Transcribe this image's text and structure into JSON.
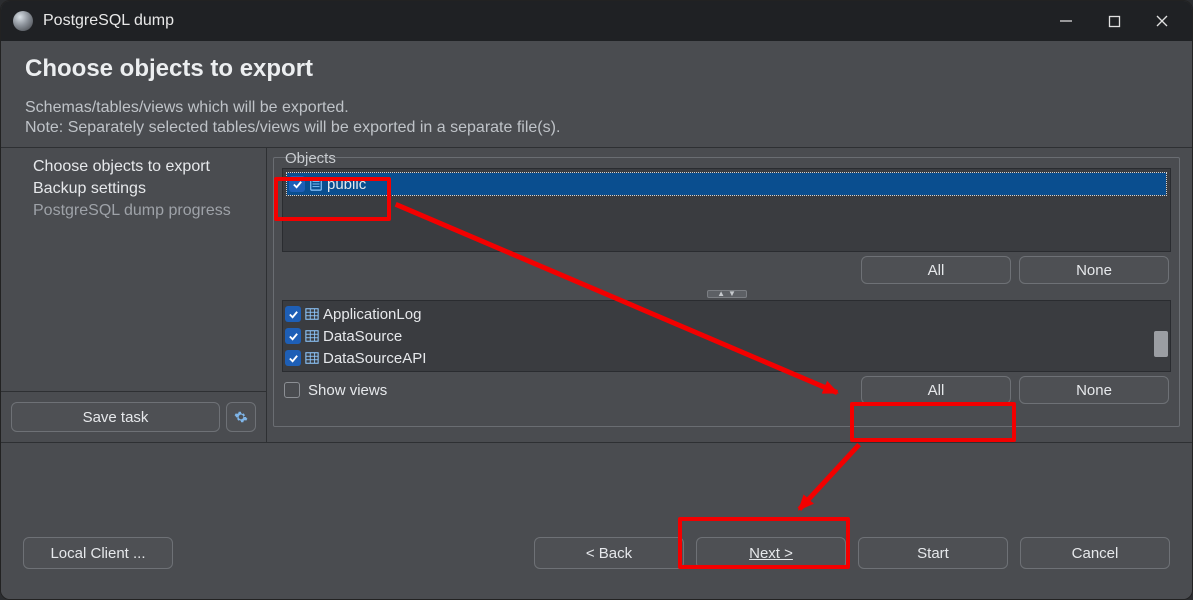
{
  "titlebar": {
    "title": "PostgreSQL dump"
  },
  "header": {
    "title": "Choose objects to export",
    "desc1": "Schemas/tables/views which will be exported.",
    "desc2": "Note: Separately selected tables/views will be exported in a separate file(s)."
  },
  "sidebar": {
    "steps": [
      {
        "label": "Choose objects to export",
        "active": true
      },
      {
        "label": "Backup settings",
        "active": true
      },
      {
        "label": "PostgreSQL dump progress",
        "active": false
      }
    ],
    "save_task": "Save task"
  },
  "objects": {
    "group_label": "Objects",
    "schemas": [
      {
        "label": "public",
        "checked": true,
        "selected": true
      }
    ],
    "schema_all": "All",
    "schema_none": "None",
    "tables": [
      {
        "label": "ApplicationLog",
        "checked": true
      },
      {
        "label": "DataSource",
        "checked": true
      },
      {
        "label": "DataSourceAPI",
        "checked": true
      }
    ],
    "show_views": "Show views",
    "table_all": "All",
    "table_none": "None"
  },
  "footer": {
    "local_client": "Local Client ...",
    "back": "< Back",
    "next": "Next >",
    "start": "Start",
    "cancel": "Cancel"
  },
  "icons": {
    "minimize": "minimize-icon",
    "maximize": "maximize-icon",
    "close": "close-icon",
    "gear": "gear-icon",
    "check": "check-icon",
    "schema": "schema-icon",
    "table": "table-icon"
  }
}
